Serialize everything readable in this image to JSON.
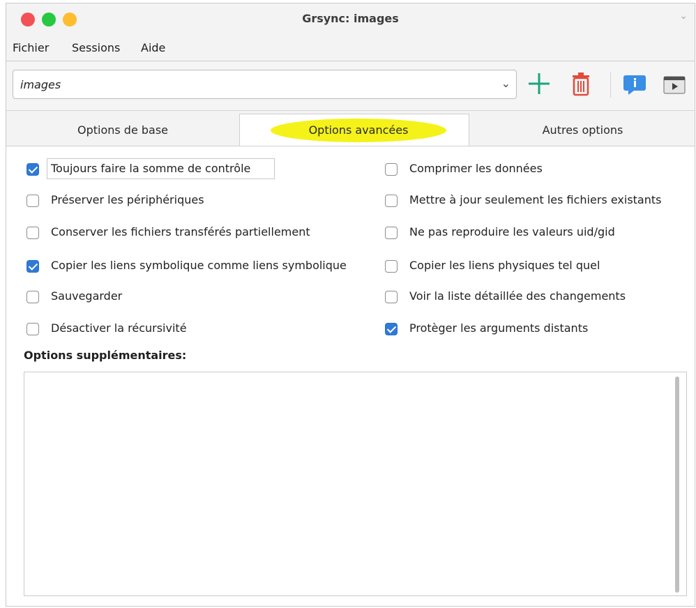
{
  "window": {
    "title": "Grsync: images"
  },
  "menu": [
    "Fichier",
    "Sessions",
    "Aide"
  ],
  "session": {
    "value": "images"
  },
  "toolbar": {
    "icons": [
      "add-session-icon",
      "delete-session-icon",
      "info-icon",
      "run-icon"
    ],
    "colors": {
      "add": "#1aa57d",
      "delete": "#e24a3b",
      "info": "#3a8ee6",
      "run": "#505050"
    }
  },
  "tabs": [
    "Options de base",
    "Options avancées",
    "Autres options"
  ],
  "active_tab": "Options avancées",
  "options_left": [
    {
      "label": "Toujours faire la somme de contrôle",
      "checked": true
    },
    {
      "label": "Préserver les périphériques",
      "checked": false
    },
    {
      "label": "Conserver les fichiers transférés partiellement",
      "checked": false
    },
    {
      "label": "Copier les liens symbolique comme liens symbolique",
      "checked": true
    },
    {
      "label": "Sauvegarder",
      "checked": false
    },
    {
      "label": "Désactiver la récursivité",
      "checked": false
    }
  ],
  "options_right": [
    {
      "label": "Comprimer les données",
      "checked": false
    },
    {
      "label": "Mettre à jour seulement les fichiers existants",
      "checked": false
    },
    {
      "label": "Ne pas reproduire les valeurs uid/gid",
      "checked": false
    },
    {
      "label": "Copier les liens physiques tel quel",
      "checked": false
    },
    {
      "label": "Voir la liste détaillée des changements",
      "checked": false
    },
    {
      "label": "Protèger les arguments distants",
      "checked": true
    }
  ],
  "extra": {
    "label": "Options supplémentaires:",
    "value": ""
  },
  "colors": {
    "checkbox_on": "#2f7ad8",
    "tab_highlight": "#f5f21a"
  }
}
